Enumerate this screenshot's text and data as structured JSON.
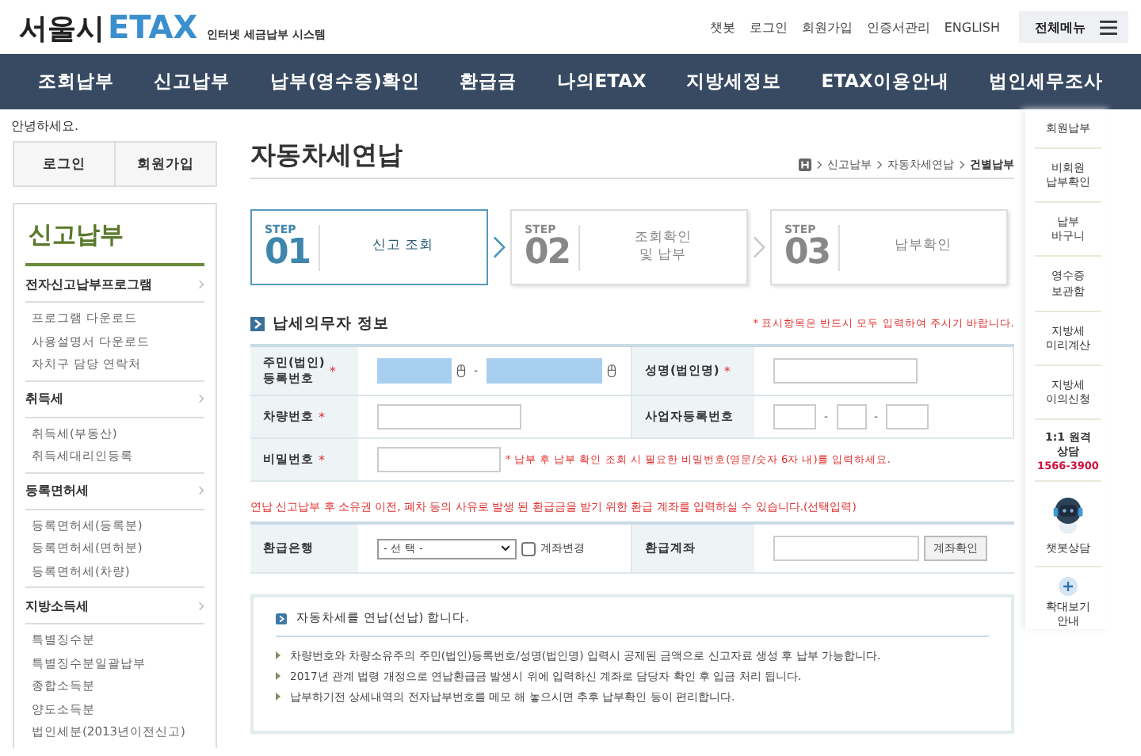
{
  "header": {
    "logo_city": "서울시",
    "logo_brand": "ETAX",
    "tagline": "인터넷 세금납부 시스템",
    "util_links": [
      "챗봇",
      "로그인",
      "회원가입",
      "인증서관리",
      "ENGLISH"
    ],
    "all_menu": "전체메뉴"
  },
  "nav": [
    "조회납부",
    "신고납부",
    "납부(영수증)확인",
    "환급금",
    "나의ETAX",
    "지방세정보",
    "ETAX이용안내",
    "법인세무조사"
  ],
  "sidebar": {
    "greeting": "안녕하세요.",
    "buttons": [
      "로그인",
      "회원가입"
    ],
    "title": "신고납부",
    "groups": [
      {
        "label": "전자신고납부프로그램",
        "children": [
          "프로그램 다운로드",
          "사용설명서 다운로드",
          "자치구 담당 연락처"
        ]
      },
      {
        "label": "취득세",
        "children": [
          "취득세(부동산)",
          "취득세대리인등록"
        ]
      },
      {
        "label": "등록면허세",
        "children": [
          "등록면허세(등록분)",
          "등록면허세(면허분)",
          "등록면허세(차량)"
        ]
      },
      {
        "label": "지방소득세",
        "children": [
          "특별징수분",
          "특별징수분일괄납부",
          "종합소득분",
          "양도소득분",
          "법인세분(2013년이전신고)"
        ]
      }
    ]
  },
  "main": {
    "title": "자동차세연납",
    "breadcrumb": [
      "신고납부",
      "자동차세연납",
      "건별납부"
    ],
    "steps": [
      {
        "step": "STEP",
        "number": "01",
        "label": "신고 조회",
        "selected": true
      },
      {
        "step": "STEP",
        "number": "02",
        "label": "조회확인\n및 납부",
        "selected": false
      },
      {
        "step": "STEP",
        "number": "03",
        "label": "납부확인",
        "selected": false
      }
    ],
    "section_title": "납세의무자 정보",
    "required_mark": "*",
    "field_separator": "-",
    "required_note": "* 표시항목은 반드시 모두 입력하여 주시기 바랍니다.",
    "rows": [
      {
        "cells": [
          {
            "label": "주민(법인)\n등록번호",
            "required": true,
            "fields": [
              {
                "kind": "secure"
              },
              {
                "kind": "secure"
              }
            ]
          },
          {
            "label": "성명(법인명)",
            "required": true,
            "fields": [
              {
                "kind": "wide"
              }
            ]
          }
        ]
      },
      {
        "cells": [
          {
            "label": "차량번호",
            "required": true,
            "fields": [
              {
                "kind": "wide"
              }
            ]
          },
          {
            "label": "사업자등록번호",
            "required": false,
            "fields": [
              {
                "kind": "short"
              },
              {
                "kind": "tiny"
              },
              {
                "kind": "short"
              }
            ]
          }
        ]
      },
      {
        "cells": [
          {
            "label": "비밀번호",
            "required": true,
            "fields": [
              {
                "kind": "medium"
              }
            ],
            "hint": "* 납부 후 납부 확인 조회 시 필요한 비밀번호(영문/숫자 6자 내)를 입력하세요."
          }
        ]
      }
    ],
    "refund_note": "연납 신고납부 후 소유권 이전, 폐차 등의 사유로 발생 된 환급금을 받기 위한 환급 계좌를 입력하실 수 있습니다.(선택입력)",
    "refund": {
      "bank_label": "환급은행",
      "bank_select": "- 선 택 -",
      "change_label": "계좌변경",
      "change_checked": false,
      "account_label": "환급계좌",
      "verify_button": "계좌확인"
    },
    "info": {
      "title": "자동차세를 연납(선납) 합니다.",
      "items": [
        "차량번호와 차량소유주의 주민(법인)등록번호/성명(법인명) 입력시 공제된 금액으로 신고자료 생성 후 납부 가능합니다.",
        "2017년 관계 법령 개정으로 연납환급금 발생시 위에 입력하신 계좌로 담당자 확인 후 입금 처리 됩니다.",
        "납부하기전 상세내역의 전자납부번호를 메모 해 놓으시면 추후 납부확인 등이 편리합니다."
      ]
    }
  },
  "quick_menu": {
    "items": [
      "회원납부",
      "비회원\n납부확인",
      "납부\n바구니",
      "영수증\n보관함",
      "지방세\n미리계산",
      "지방세\n이의신청"
    ],
    "consult": "1:1 원격\n상담",
    "phone": "1566-3900",
    "chatbot": "챗봇상담",
    "zoom": "확대보기\n안내"
  }
}
